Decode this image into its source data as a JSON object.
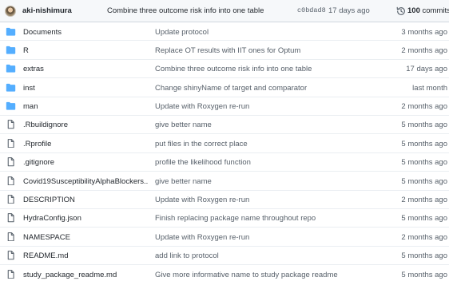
{
  "header": {
    "author": "aki-nishimura",
    "commit_message": "Combine three outcome risk info into one table",
    "sha": "c0bdad8",
    "age": "17 days ago",
    "commit_count": "100",
    "commits_label": "commits"
  },
  "colors": {
    "folder": "#54aeff",
    "file": "#57606a"
  },
  "rows": [
    {
      "type": "folder",
      "icon": "folder-icon",
      "name": "Documents",
      "message": "Update protocol",
      "date": "3 months ago"
    },
    {
      "type": "folder",
      "icon": "folder-icon",
      "name": "R",
      "message": "Replace OT results with IIT ones for Optum",
      "date": "2 months ago"
    },
    {
      "type": "folder",
      "icon": "folder-icon",
      "name": "extras",
      "message": "Combine three outcome risk info into one table",
      "date": "17 days ago"
    },
    {
      "type": "folder",
      "icon": "folder-icon",
      "name": "inst",
      "message": "Change shinyName of target and comparator",
      "date": "last month"
    },
    {
      "type": "folder",
      "icon": "folder-icon",
      "name": "man",
      "message": "Update with Roxygen re-run",
      "date": "2 months ago"
    },
    {
      "type": "file",
      "icon": "file-icon",
      "name": ".Rbuildignore",
      "message": "give better name",
      "date": "5 months ago"
    },
    {
      "type": "file",
      "icon": "file-icon",
      "name": ".Rprofile",
      "message": "put files in the correct place",
      "date": "5 months ago"
    },
    {
      "type": "file",
      "icon": "file-icon",
      "name": ".gitignore",
      "message": "profile the likelihood function",
      "date": "5 months ago"
    },
    {
      "type": "file",
      "icon": "file-icon",
      "name": "Covid19SusceptibilityAlphaBlockers....",
      "message": "give better name",
      "date": "5 months ago"
    },
    {
      "type": "file",
      "icon": "file-icon",
      "name": "DESCRIPTION",
      "message": "Update with Roxygen re-run",
      "date": "2 months ago"
    },
    {
      "type": "file",
      "icon": "file-icon",
      "name": "HydraConfig.json",
      "message": "Finish replacing package name throughout repo",
      "date": "5 months ago"
    },
    {
      "type": "file",
      "icon": "file-icon",
      "name": "NAMESPACE",
      "message": "Update with Roxygen re-run",
      "date": "2 months ago"
    },
    {
      "type": "file",
      "icon": "file-icon",
      "name": "README.md",
      "message": "add link to protocol",
      "date": "5 months ago"
    },
    {
      "type": "file",
      "icon": "file-icon",
      "name": "study_package_readme.md",
      "message": "Give more informative name to study package readme",
      "date": "5 months ago"
    }
  ]
}
